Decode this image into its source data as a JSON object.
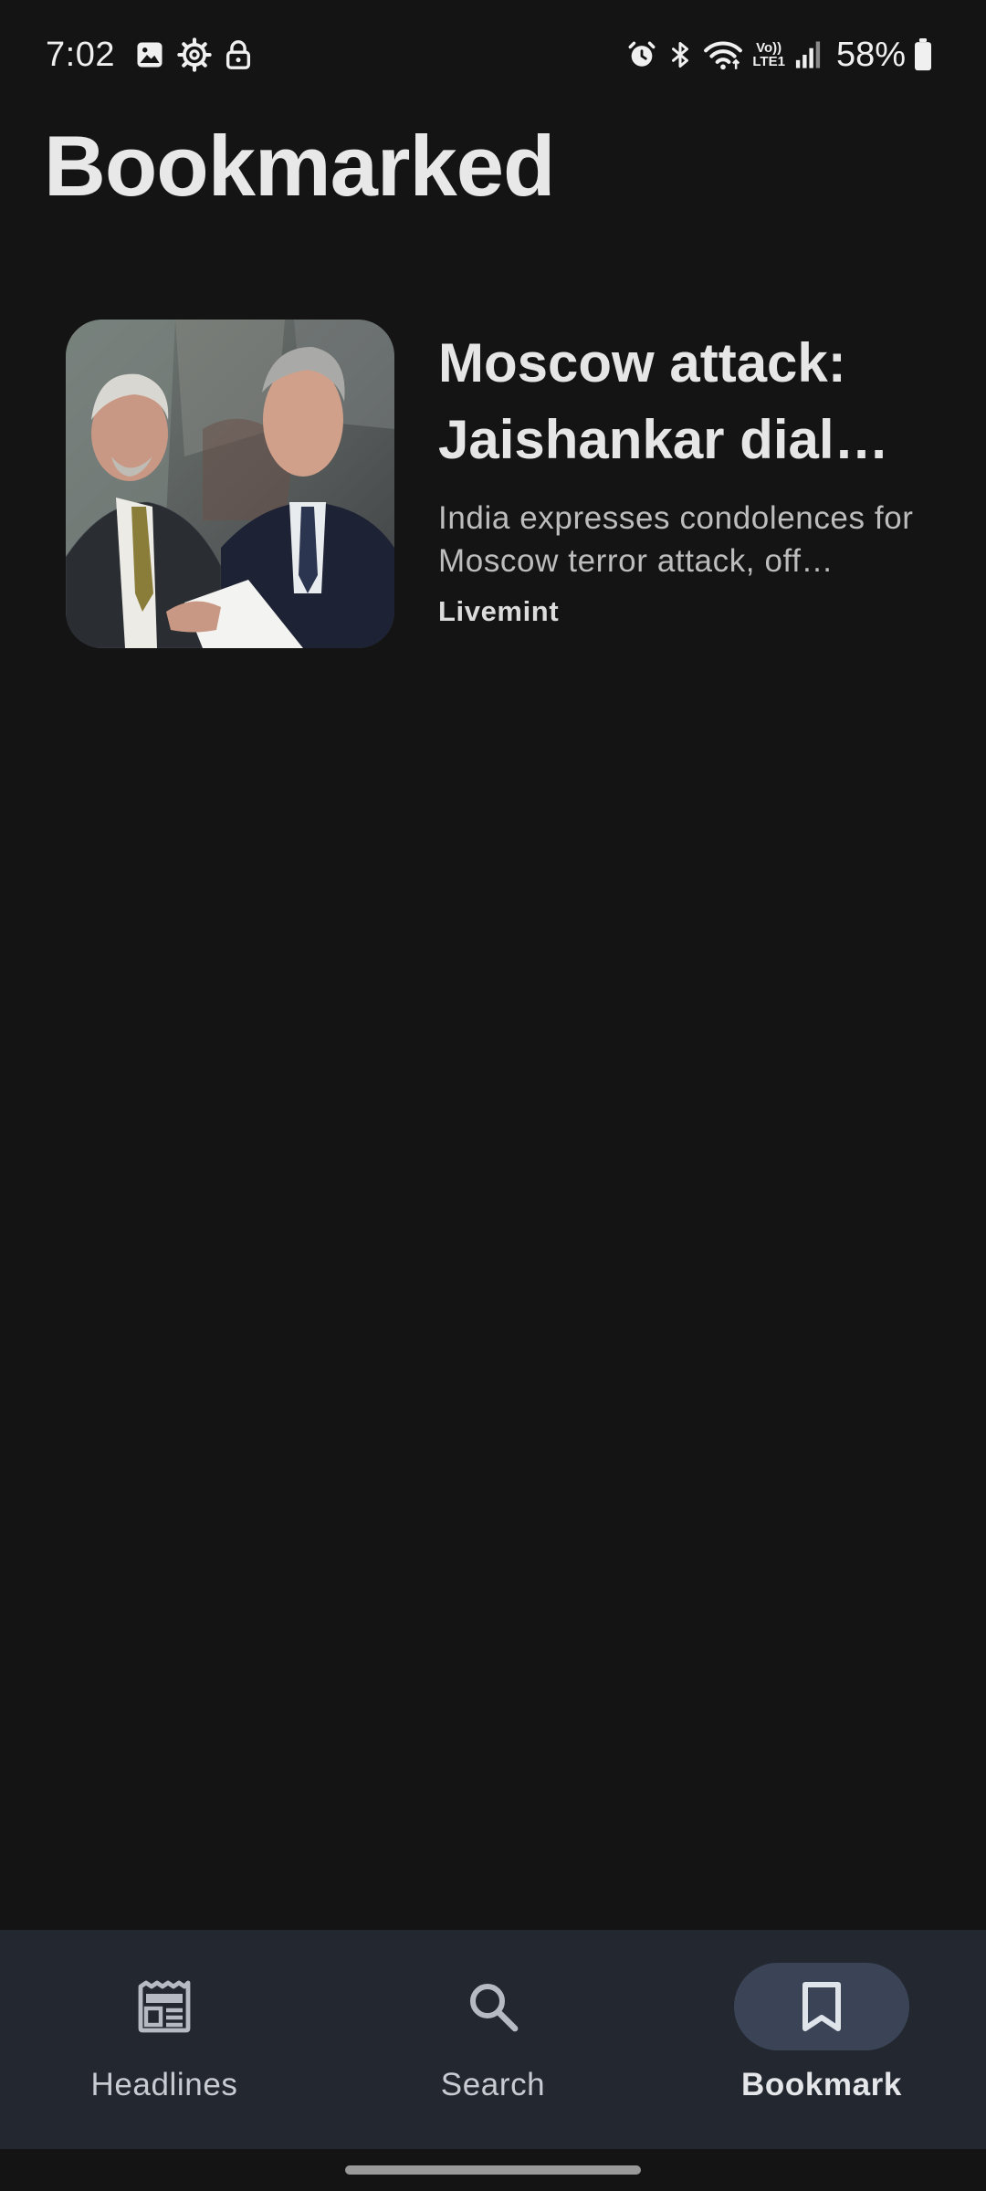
{
  "status_bar": {
    "time": "7:02",
    "left_icons": [
      "gallery-icon",
      "settings-gear-icon",
      "lock-icon"
    ],
    "right_icons": [
      "alarm-icon",
      "bluetooth-icon",
      "wifi-icon",
      "volte-lte-icon",
      "signal-icon"
    ],
    "network_label_top": "Vo))",
    "network_label_bottom": "LTE1",
    "battery_percent": "58%",
    "battery_level": 0.58
  },
  "page": {
    "title": "Bookmarked"
  },
  "articles": [
    {
      "title": "Moscow attack: Jaishankar dial…",
      "description": "India expresses condolences for Moscow terror attack, off…",
      "source": "Livemint"
    }
  ],
  "bottom_nav": {
    "items": [
      {
        "label": "Headlines",
        "icon": "newspaper-icon",
        "active": false
      },
      {
        "label": "Search",
        "icon": "search-icon",
        "active": false
      },
      {
        "label": "Bookmark",
        "icon": "bookmark-icon",
        "active": true
      }
    ],
    "active_color": "#3b4456",
    "background": "#232730"
  },
  "colors": {
    "background": "#141414",
    "title_text": "#e8e8e8",
    "secondary_text": "#bdbdbd"
  }
}
